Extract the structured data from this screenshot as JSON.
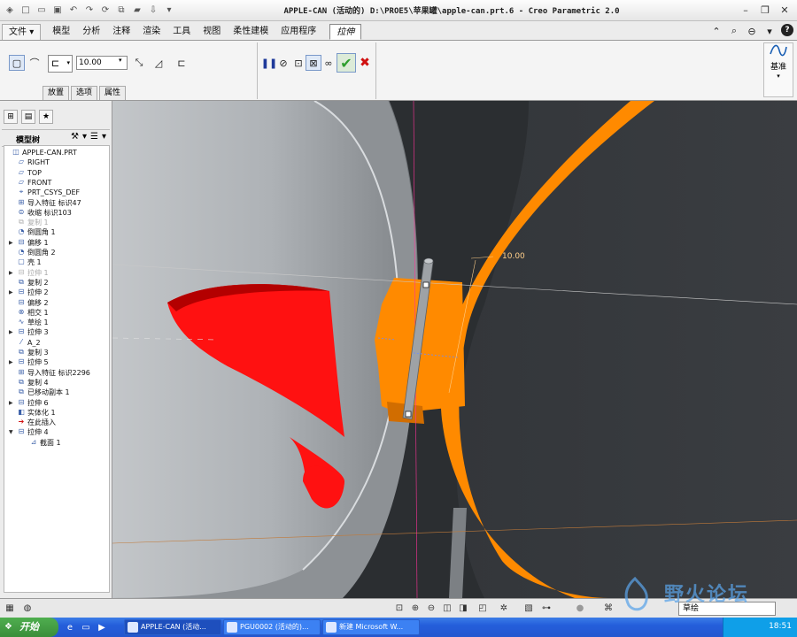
{
  "window": {
    "title": "APPLE-CAN (活动的) D:\\PROE5\\苹果罐\\apple-can.prt.6 - Creo Parametric 2.0"
  },
  "menu": {
    "tabs": [
      "文件",
      "模型",
      "分析",
      "注释",
      "渲染",
      "工具",
      "视图",
      "柔性建模",
      "应用程序",
      "拉伸"
    ],
    "file_arrow": "▾"
  },
  "ribbon": {
    "depth_value": "10.00",
    "subtabs": [
      "放置",
      "选项",
      "属性"
    ],
    "datum_label": "基准"
  },
  "model_tree": {
    "title": "模型树",
    "items": [
      {
        "label": "APPLE-CAN.PRT",
        "dim": false,
        "expand": ""
      },
      {
        "label": "RIGHT",
        "dim": false,
        "expand": ""
      },
      {
        "label": "TOP",
        "dim": false,
        "expand": ""
      },
      {
        "label": "FRONT",
        "dim": false,
        "expand": ""
      },
      {
        "label": "PRT_CSYS_DEF",
        "dim": false,
        "expand": ""
      },
      {
        "label": "导入特征 标识47",
        "dim": false,
        "expand": ""
      },
      {
        "label": "收缩 标识103",
        "dim": false,
        "expand": ""
      },
      {
        "label": "复制 1",
        "dim": true,
        "expand": ""
      },
      {
        "label": "倒圆角 1",
        "dim": false,
        "expand": ""
      },
      {
        "label": "偏移 1",
        "dim": false,
        "expand": "▶"
      },
      {
        "label": "倒圆角 2",
        "dim": false,
        "expand": ""
      },
      {
        "label": "壳 1",
        "dim": false,
        "expand": ""
      },
      {
        "label": "拉伸 1",
        "dim": true,
        "expand": "▶"
      },
      {
        "label": "复制 2",
        "dim": false,
        "expand": ""
      },
      {
        "label": "拉伸 2",
        "dim": false,
        "expand": "▶"
      },
      {
        "label": "偏移 2",
        "dim": false,
        "expand": ""
      },
      {
        "label": "相交 1",
        "dim": false,
        "expand": ""
      },
      {
        "label": "草绘 1",
        "dim": false,
        "expand": ""
      },
      {
        "label": "拉伸 3",
        "dim": false,
        "expand": "▶"
      },
      {
        "label": "A_2",
        "dim": false,
        "expand": ""
      },
      {
        "label": "复制 3",
        "dim": false,
        "expand": ""
      },
      {
        "label": "拉伸 5",
        "dim": false,
        "expand": "▶"
      },
      {
        "label": "导入特征 标识2296",
        "dim": false,
        "expand": ""
      },
      {
        "label": "复制 4",
        "dim": false,
        "expand": ""
      },
      {
        "label": "已移动副本 1",
        "dim": false,
        "expand": ""
      },
      {
        "label": "拉伸 6",
        "dim": false,
        "expand": "▶"
      },
      {
        "label": "实体化 1",
        "dim": false,
        "expand": ""
      },
      {
        "label": "在此插入",
        "dim": false,
        "expand": ""
      },
      {
        "label": "拉伸 4",
        "dim": false,
        "expand": "▼"
      },
      {
        "label": "截面 1",
        "dim": false,
        "expand": ""
      }
    ]
  },
  "viewport": {
    "dimension_label": "10.00"
  },
  "statusbar": {
    "filter_value": "草绘"
  },
  "taskbar": {
    "start_label": "开始",
    "tasks": [
      "APPLE-CAN (活动...",
      "PGU0002 (活动的)...",
      "新建 Microsoft W..."
    ],
    "clock": "18:51"
  },
  "watermark": {
    "text": "野火论坛"
  },
  "colors": {
    "orange": "#ff8a00",
    "red": "#ff1111",
    "gray_surface": "#a9adb1",
    "viewport_bg": "#2b2e31",
    "accent_check": "#2e9e2e",
    "accent_cancel": "#d01010"
  }
}
